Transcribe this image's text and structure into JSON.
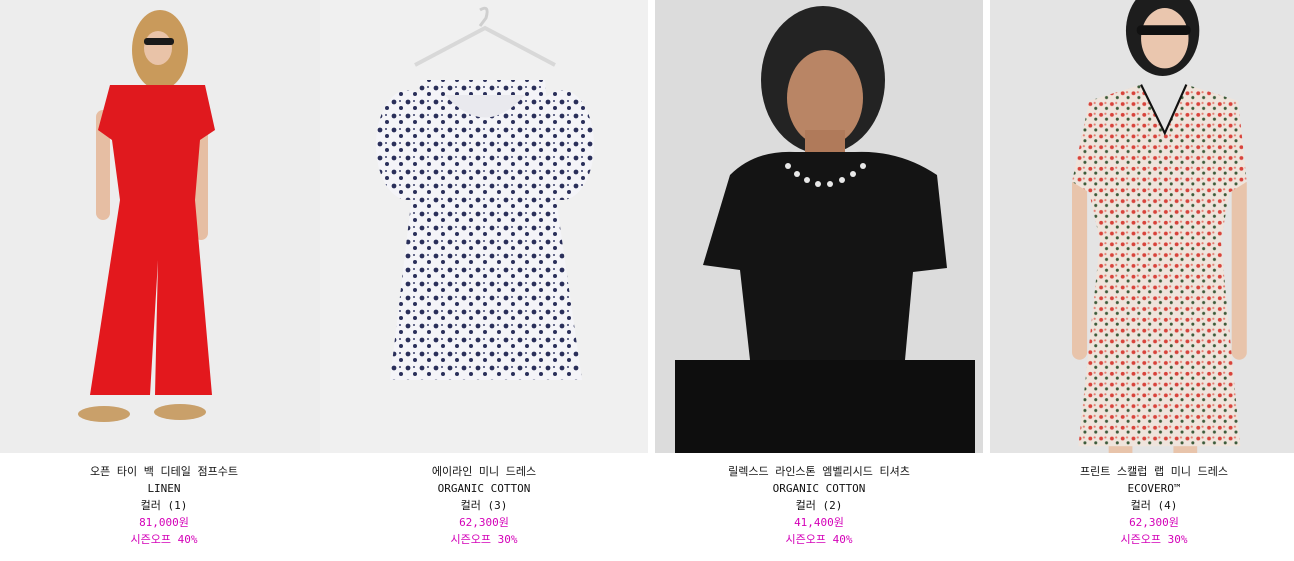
{
  "colors": {
    "background": "#ffffff",
    "image_bg_1": "#ededed",
    "image_bg_2": "#f0f0f0",
    "image_bg_3": "#dcdcdc",
    "image_bg_4": "#e4e4e4",
    "text": "#111111",
    "price_accent": "#d400b8"
  },
  "products": [
    {
      "name": "오픈 타이 백 디테일 점프수트",
      "material": "LINEN",
      "colors_label": "컬러 (1)",
      "price": "81,000원",
      "discount": "시즌오프 40%",
      "image_icon": "red-jumpsuit-photo"
    },
    {
      "name": "에이라인 미니 드레스",
      "material": "ORGANIC COTTON",
      "colors_label": "컬러 (3)",
      "price": "62,300원",
      "discount": "시즌오프 30%",
      "image_icon": "floral-mini-dress-photo"
    },
    {
      "name": "릴렉스드 라인스톤 엠벨리시드 티셔츠",
      "material": "ORGANIC COTTON",
      "colors_label": "컬러 (2)",
      "price": "41,400원",
      "discount": "시즌오프 40%",
      "image_icon": "black-tshirt-photo"
    },
    {
      "name": "프린트 스캘럽 랩 미니 드레스",
      "material": "ECOVERO™",
      "colors_label": "컬러 (4)",
      "price": "62,300원",
      "discount": "시즌오프 30%",
      "image_icon": "print-wrap-dress-photo"
    }
  ]
}
